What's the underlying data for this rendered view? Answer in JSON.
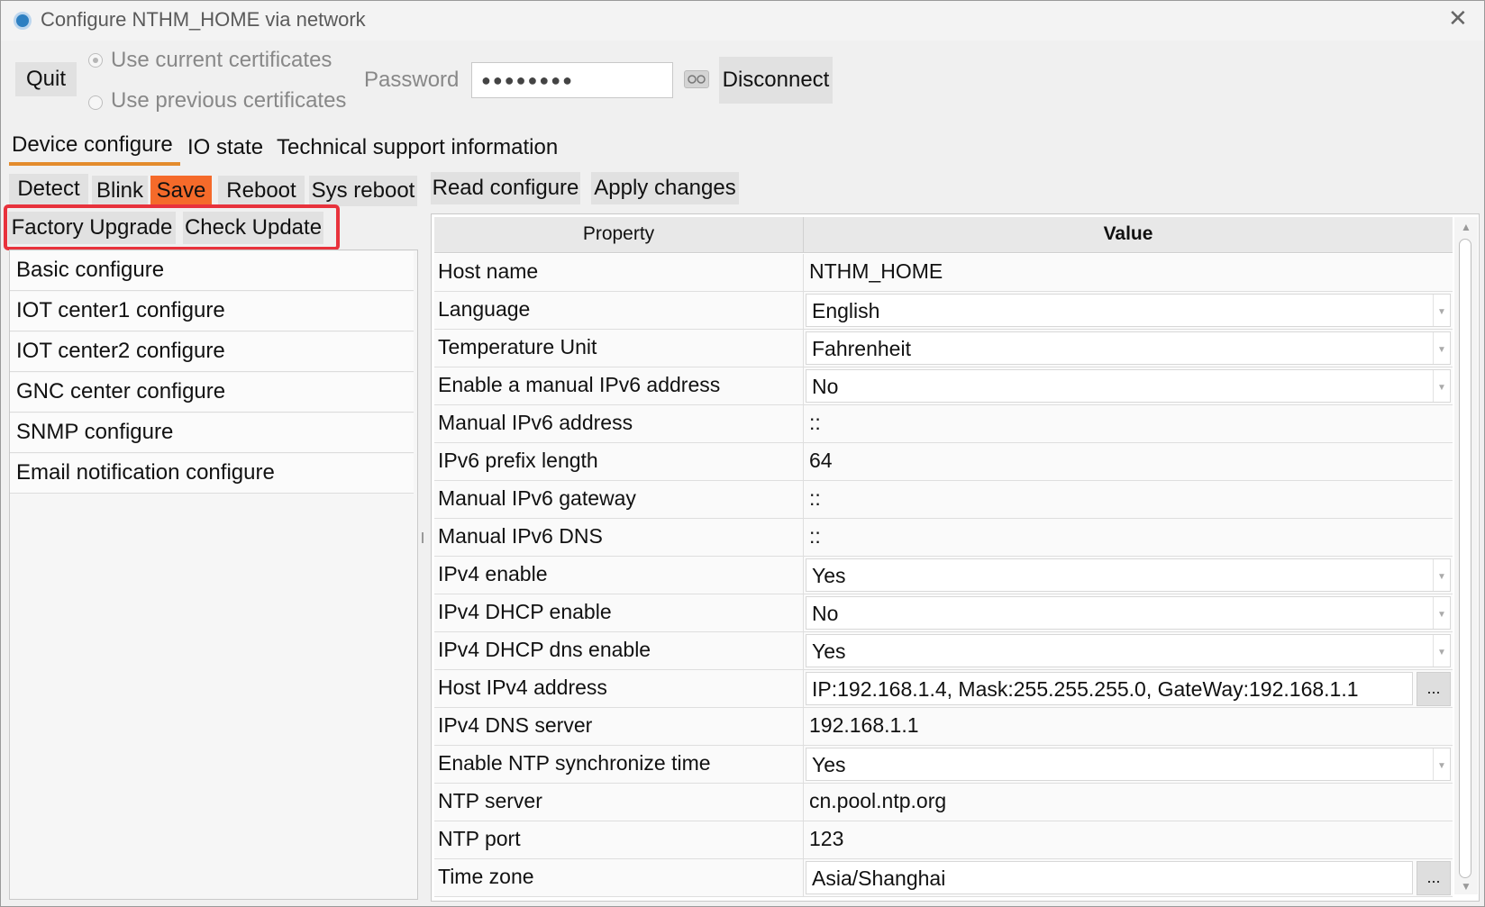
{
  "window": {
    "title": "Configure NTHM_HOME via network",
    "close_glyph": "✕",
    "app_icon": "gear-circle-icon"
  },
  "toolbar": {
    "quit_label": "Quit",
    "cert_current_label": "Use current certificates",
    "cert_previous_label": "Use previous certificates",
    "password_label": "Password",
    "password_value": "●●●●●●●●",
    "disconnect_label": "Disconnect",
    "show_password_icon": "eye-icon"
  },
  "tabs": [
    {
      "label": "Device configure",
      "selected": true
    },
    {
      "label": "IO state",
      "selected": false
    },
    {
      "label": "Technical support information",
      "selected": false
    }
  ],
  "actions": {
    "detect": "Detect",
    "blink": "Blink",
    "save": "Save",
    "reboot": "Reboot",
    "sys_reboot": "Sys reboot",
    "factory_upgrade": "Factory Upgrade",
    "check_update": "Check Update",
    "read_configure": "Read configure",
    "apply_changes": "Apply changes"
  },
  "colors": {
    "save_bg": "#f56a2a",
    "highlight_box": "#e8323c",
    "tab_underline": "#e38b2c"
  },
  "config_sections": [
    "Basic configure",
    "IOT center1 configure",
    "IOT center2 configure",
    "GNC center configure",
    "SNMP configure",
    "Email notification configure"
  ],
  "table": {
    "headers": {
      "property": "Property",
      "value": "Value"
    },
    "rows": [
      {
        "property": "Host name",
        "value": "NTHM_HOME",
        "kind": "text"
      },
      {
        "property": "Language",
        "value": "English",
        "kind": "combo"
      },
      {
        "property": "Temperature Unit",
        "value": "Fahrenheit",
        "kind": "combo"
      },
      {
        "property": "Enable a manual IPv6 address",
        "value": "No",
        "kind": "combo"
      },
      {
        "property": "Manual IPv6 address",
        "value": "::",
        "kind": "text"
      },
      {
        "property": "IPv6 prefix length",
        "value": "64",
        "kind": "text"
      },
      {
        "property": "Manual IPv6 gateway",
        "value": "::",
        "kind": "text"
      },
      {
        "property": "Manual IPv6 DNS",
        "value": "::",
        "kind": "text"
      },
      {
        "property": "IPv4 enable",
        "value": "Yes",
        "kind": "combo"
      },
      {
        "property": "IPv4 DHCP enable",
        "value": "No",
        "kind": "combo"
      },
      {
        "property": "IPv4 DHCP dns enable",
        "value": "Yes",
        "kind": "combo"
      },
      {
        "property": "Host IPv4 address",
        "value": "IP:192.168.1.4, Mask:255.255.255.0, GateWay:192.168.1.1",
        "kind": "ellipsis",
        "button": "..."
      },
      {
        "property": "IPv4 DNS server",
        "value": "192.168.1.1",
        "kind": "text"
      },
      {
        "property": "Enable NTP synchronize time",
        "value": "Yes",
        "kind": "combo"
      },
      {
        "property": "NTP server",
        "value": "cn.pool.ntp.org",
        "kind": "text"
      },
      {
        "property": "NTP port",
        "value": "123",
        "kind": "text"
      },
      {
        "property": "Time zone",
        "value": "Asia/Shanghai",
        "kind": "ellipsis",
        "button": "..."
      }
    ]
  }
}
